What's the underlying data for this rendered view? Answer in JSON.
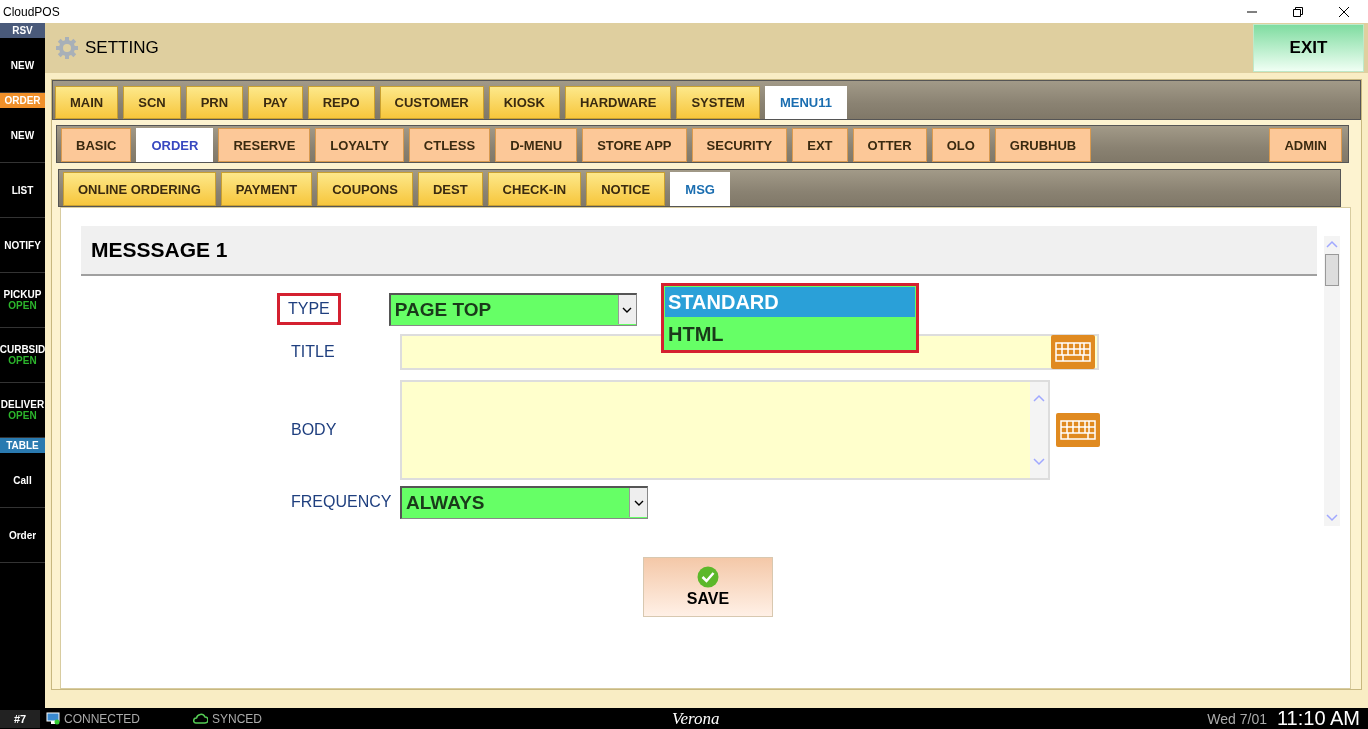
{
  "window": {
    "title": "CloudPOS"
  },
  "sidebar": [
    {
      "kind": "header",
      "label": "RSV",
      "color": "#4a5a7a"
    },
    {
      "kind": "button",
      "label": "NEW"
    },
    {
      "kind": "header",
      "label": "ORDER",
      "color": "#f0902a"
    },
    {
      "kind": "button",
      "label": "NEW"
    },
    {
      "kind": "button",
      "label": "LIST"
    },
    {
      "kind": "button",
      "label": "NOTIFY"
    },
    {
      "kind": "button",
      "label": "PICKUP",
      "status": "OPEN"
    },
    {
      "kind": "button",
      "label": "CURBSID",
      "status": "OPEN"
    },
    {
      "kind": "button",
      "label": "DELIVER",
      "status": "OPEN"
    },
    {
      "kind": "header",
      "label": "TABLE",
      "color": "#2a7ab0"
    },
    {
      "kind": "button",
      "label": "Call"
    },
    {
      "kind": "button",
      "label": "Order"
    }
  ],
  "header": {
    "title": "SETTING",
    "exit": "EXIT"
  },
  "tab_rows": [
    {
      "tabs": [
        {
          "label": "MAIN",
          "selected": false
        },
        {
          "label": "SCN",
          "selected": false
        },
        {
          "label": "PRN",
          "selected": false
        },
        {
          "label": "PAY",
          "selected": false
        },
        {
          "label": "REPO",
          "selected": false
        },
        {
          "label": "CUSTOMER",
          "selected": false
        },
        {
          "label": "KIOSK",
          "selected": false
        },
        {
          "label": "HARDWARE",
          "selected": false
        },
        {
          "label": "SYSTEM",
          "selected": false
        },
        {
          "label": "MENU11",
          "selected": true
        }
      ]
    },
    {
      "tabs": [
        {
          "label": "BASIC",
          "selected": false
        },
        {
          "label": "ORDER",
          "selected": true
        },
        {
          "label": "RESERVE",
          "selected": false
        },
        {
          "label": "LOYALTY",
          "selected": false
        },
        {
          "label": "CTLESS",
          "selected": false
        },
        {
          "label": "D-MENU",
          "selected": false
        },
        {
          "label": "STORE APP",
          "selected": false
        },
        {
          "label": "SECURITY",
          "selected": false
        },
        {
          "label": "EXT",
          "selected": false
        },
        {
          "label": "OTTER",
          "selected": false
        },
        {
          "label": "OLO",
          "selected": false
        },
        {
          "label": "GRUBHUB",
          "selected": false
        },
        {
          "label": "ADMIN",
          "selected": false
        }
      ]
    },
    {
      "tabs": [
        {
          "label": "ONLINE ORDERING",
          "selected": false
        },
        {
          "label": "PAYMENT",
          "selected": false
        },
        {
          "label": "COUPONS",
          "selected": false
        },
        {
          "label": "DEST",
          "selected": false
        },
        {
          "label": "CHECK-IN",
          "selected": false
        },
        {
          "label": "NOTICE",
          "selected": false
        },
        {
          "label": "MSG",
          "selected": true
        }
      ]
    }
  ],
  "section": {
    "title": "MESSSAGE 1"
  },
  "form": {
    "type": {
      "label": "TYPE",
      "highlighted": true,
      "value": "PAGE TOP",
      "options_open": true,
      "options": [
        {
          "label": "STANDARD",
          "selected": true
        },
        {
          "label": "HTML",
          "selected": false
        }
      ]
    },
    "title": {
      "label": "TITLE"
    },
    "body": {
      "label": "BODY"
    },
    "frequency": {
      "label": "FREQUENCY",
      "value": "ALWAYS"
    }
  },
  "save": "SAVE",
  "status_bar": {
    "station": "#7",
    "connection": "CONNECTED",
    "sync": "SYNCED",
    "store": "Verona",
    "date": "Wed 7/01",
    "time": "11:10 AM"
  }
}
